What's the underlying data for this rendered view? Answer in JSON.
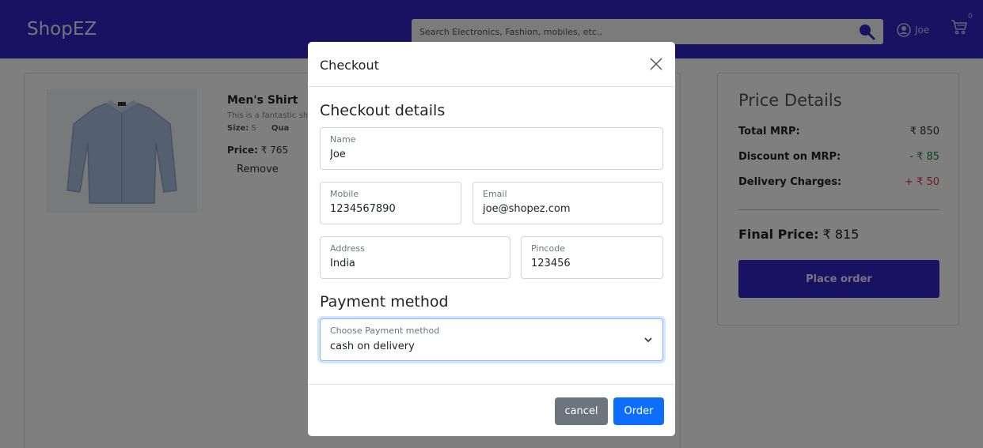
{
  "header": {
    "brand": "ShopEZ",
    "search_placeholder": "Search Electronics, Fashion, mobiles, etc.,",
    "user_name": "Joe",
    "cart_count": "0"
  },
  "cart": {
    "product": {
      "name": "Men's Shirt",
      "description": "This is a fantastic sh",
      "size_label": "Size:",
      "size_value": "S",
      "quantity_label": "Qua",
      "price_label": "Price:",
      "price_value": "₹ 765",
      "remove_label": "Remove"
    }
  },
  "price_details": {
    "title": "Price Details",
    "rows": [
      {
        "label": "Total MRP:",
        "value": "₹ 850"
      },
      {
        "label": "Discount on MRP:",
        "value": "- ₹ 85"
      },
      {
        "label": "Delivery Charges:",
        "value": "+ ₹ 50"
      }
    ],
    "final_label": "Final Price:",
    "final_value": "₹ 815",
    "place_order_label": "Place order"
  },
  "colors": {
    "brand": "#2f26c4",
    "discount": "#198754",
    "delivery": "#dc3545",
    "primary": "#0d6efd",
    "secondary": "#6c757d"
  },
  "modal": {
    "title": "Checkout",
    "details_heading": "Checkout details",
    "fields": {
      "name": {
        "label": "Name",
        "value": "Joe"
      },
      "mobile": {
        "label": "Mobile",
        "value": "1234567890"
      },
      "email": {
        "label": "Email",
        "value": "joe@shopez.com"
      },
      "address": {
        "label": "Address",
        "value": "India"
      },
      "pincode": {
        "label": "Pincode",
        "value": "123456"
      }
    },
    "payment_heading": "Payment method",
    "payment": {
      "label": "Choose Payment method",
      "value": "cash on delivery"
    },
    "cancel_label": "cancel",
    "order_label": "Order"
  }
}
